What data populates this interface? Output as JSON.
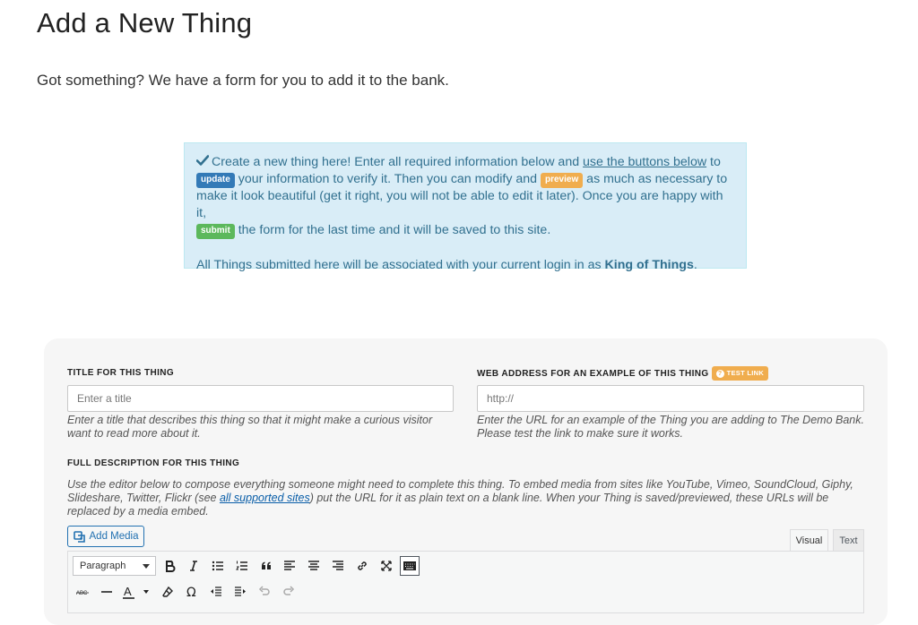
{
  "page": {
    "title": "Add a New Thing",
    "intro": "Got something? We have a form for you to add it to the bank."
  },
  "notice": {
    "line1_pre": "Create a new thing here! Enter all required information below and ",
    "link": "use the buttons below",
    "line1_post": " to",
    "update_label": "update",
    "verify_text": " your information to verify it. Then you can modify and ",
    "preview_label": "preview",
    "beautiful_text": " as much as necessary to make it look beautiful (get it right, you will not be able to edit it later). Once you are happy with it, ",
    "submit_label": "submit",
    "final_text": " the form for the last time and it will be saved to this site.",
    "assoc_pre": "All Things submitted here will be associated with your current login in as ",
    "user": "King of Things",
    "assoc_post": "."
  },
  "form": {
    "title_label": "TITLE FOR THIS THING",
    "title_placeholder": "Enter a title",
    "title_value": "",
    "title_help": "Enter a title that describes this thing so that it might make a curious visitor want to read more about it.",
    "url_label": "WEB ADDRESS FOR AN EXAMPLE OF THIS THING",
    "test_link": "TEST LINK",
    "url_placeholder": "http://",
    "url_value": "",
    "url_help": "Enter the URL for an example of the Thing you are adding to The Demo Bank. Please test the link to make sure it works.",
    "desc_label": "FULL DESCRIPTION FOR THIS THING",
    "desc_help_pre": "Use the editor below to compose everything someone might need to complete this thing. To embed media from sites like YouTube, Vimeo, SoundCloud, Giphy, Slideshare, Twitter, Flickr (see ",
    "desc_help_link": "all supported sites",
    "desc_help_post": ") put the URL for it as plain text on a blank line. When your Thing is saved/previewed, these URLs will be replaced by a media embed."
  },
  "editor": {
    "add_media": "Add Media",
    "tab_visual": "Visual",
    "tab_text": "Text",
    "format_value": "Paragraph",
    "toolbar1": [
      "bold-icon",
      "italic-icon",
      "bulleted-list-icon",
      "numbered-list-icon",
      "blockquote-icon",
      "align-left-icon",
      "align-center-icon",
      "align-right-icon",
      "link-icon",
      "fullscreen-icon",
      "toolbar-toggle-icon"
    ],
    "toolbar2": [
      "strikethrough-icon",
      "horizontal-line-icon",
      "text-color-icon",
      "clear-formatting-icon",
      "special-character-icon",
      "outdent-icon",
      "indent-icon",
      "undo-icon",
      "redo-icon"
    ]
  },
  "colors": {
    "notice_bg": "#d9edf7",
    "notice_text": "#31708f",
    "update": "#337ab7",
    "preview": "#f0ad4e",
    "submit": "#5cb85c",
    "link_blue": "#2271b1"
  }
}
